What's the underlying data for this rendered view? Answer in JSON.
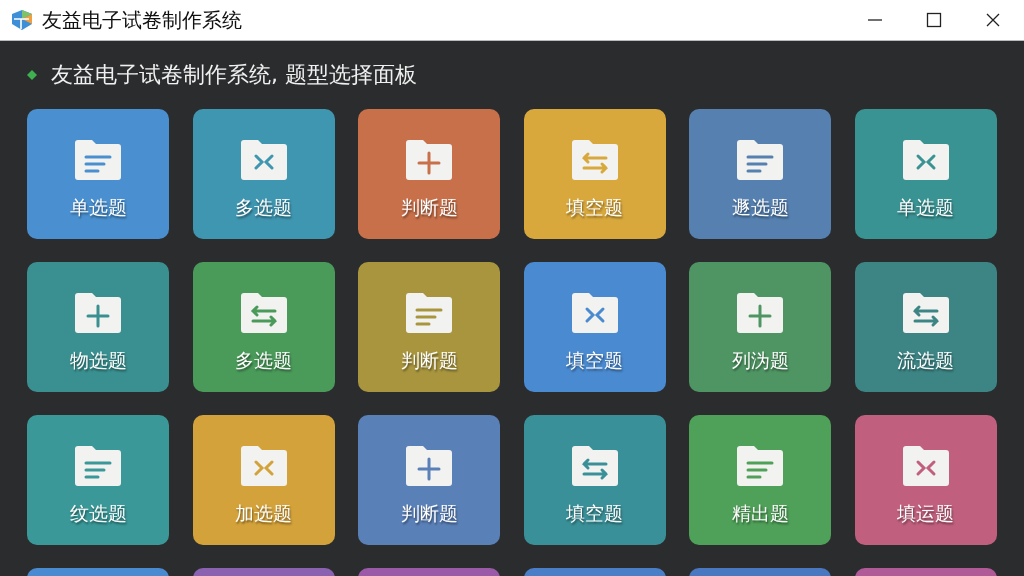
{
  "window": {
    "title": "友益电子试卷制作系统"
  },
  "header": {
    "title": "友益电子试卷制作系统, 题型选择面板"
  },
  "tiles": [
    {
      "label": "单选题",
      "color": "#4a90d0"
    },
    {
      "label": "多选题",
      "color": "#3f96b0"
    },
    {
      "label": "判断题",
      "color": "#c8704a"
    },
    {
      "label": "填空题",
      "color": "#d9a83c"
    },
    {
      "label": "遯选题",
      "color": "#5580b0"
    },
    {
      "label": "单选题",
      "color": "#3a9393"
    },
    {
      "label": "物选题",
      "color": "#3a9090"
    },
    {
      "label": "多选题",
      "color": "#4a9a5a"
    },
    {
      "label": "判断题",
      "color": "#a8953e"
    },
    {
      "label": "填空题",
      "color": "#4a8ad0"
    },
    {
      "label": "列沩题",
      "color": "#4f9563"
    },
    {
      "label": "流选题",
      "color": "#3d8585"
    },
    {
      "label": "纹选题",
      "color": "#3a9898"
    },
    {
      "label": "加选题",
      "color": "#d4a23a"
    },
    {
      "label": "判断题",
      "color": "#5a80b8"
    },
    {
      "label": "填空题",
      "color": "#3a9098"
    },
    {
      "label": "精出题",
      "color": "#4fa058"
    },
    {
      "label": "填运题",
      "color": "#c0607e"
    },
    {
      "color": "#4a8ad0"
    },
    {
      "color": "#8a62b0"
    },
    {
      "color": "#9a5aa8"
    },
    {
      "color": "#4a7fc8"
    },
    {
      "color": "#4a78c0"
    },
    {
      "color": "#b05a98"
    }
  ]
}
